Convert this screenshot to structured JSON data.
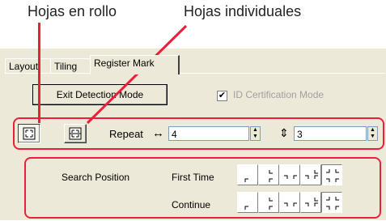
{
  "annotations": {
    "rolls_label": "Hojas en rollo",
    "sheets_label": "Hojas individuales",
    "highlight_color": "#e8203a"
  },
  "tabs": [
    {
      "label": "Layout",
      "active": false
    },
    {
      "label": "Tiling",
      "active": false
    },
    {
      "label": "Register Mark",
      "active": true
    }
  ],
  "register_mark": {
    "exit_button": "Exit Detection Mode",
    "id_cert": {
      "label": "ID Certification Mode",
      "checked": true,
      "enabled": false
    },
    "media_buttons": [
      {
        "name": "roll-media-icon",
        "pressed": true
      },
      {
        "name": "sheet-media-icon",
        "pressed": false
      }
    ],
    "repeat_label": "Repeat",
    "horizontal_arrow": "↔",
    "horizontal_value": "4",
    "vertical_arrow": "⇕",
    "vertical_value": "3",
    "search_position": {
      "label": "Search Position",
      "rows": [
        {
          "label": "First Time"
        },
        {
          "label": "Continue"
        }
      ]
    }
  }
}
